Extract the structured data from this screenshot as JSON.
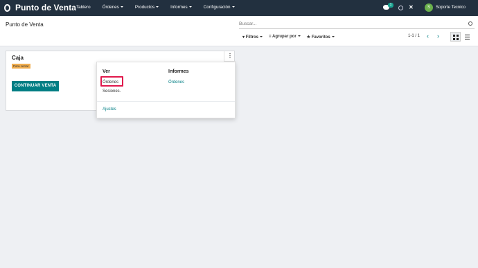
{
  "app": {
    "title": "Punto de Venta",
    "menu": [
      "Tablero",
      "Órdenes",
      "Productos",
      "Informes",
      "Configuración"
    ],
    "menu_has_caret": [
      false,
      true,
      true,
      true,
      true
    ],
    "chat_count": "1",
    "user_initial": "S",
    "user_name": "Soporte Tecnico",
    "tools_glyph": "✕",
    "accent_color": "#017e84",
    "topbar_color": "#22303f"
  },
  "control": {
    "page_title": "Punto de Venta",
    "search_placeholder": "Buscar...",
    "filters_label": "Filtros",
    "group_label": "Agrupar por",
    "favorites_label": "Favoritos",
    "pager": "1-1 / 1",
    "pager_prev": "‹",
    "pager_next": "›"
  },
  "card": {
    "title": "Caja",
    "badge": "Para cerrar",
    "continue_label": "CONTINUAR VENTA",
    "kebab": "⋮"
  },
  "dropdown": {
    "ver_title": "Ver",
    "ver_items": [
      "Órdenes",
      "Sesiones."
    ],
    "informes_title": "Informes",
    "informes_items": [
      "Órdenes"
    ],
    "settings_label": "Ajustes"
  }
}
